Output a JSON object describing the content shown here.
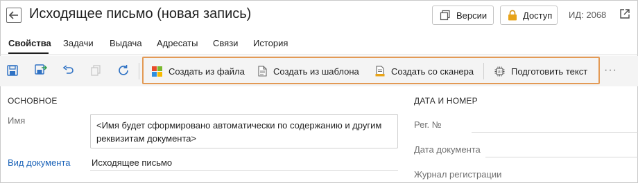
{
  "header": {
    "title": "Исходящее письмо (новая запись)",
    "versions_label": "Версии",
    "access_label": "Доступ",
    "id_label": "ИД: 2068"
  },
  "tabs": [
    {
      "label": "Свойства",
      "active": true
    },
    {
      "label": "Задачи"
    },
    {
      "label": "Выдача"
    },
    {
      "label": "Адресаты"
    },
    {
      "label": "Связи"
    },
    {
      "label": "История"
    }
  ],
  "toolbar": {
    "actions": [
      {
        "label": "Создать из файла",
        "icon": "windows-logo-icon"
      },
      {
        "label": "Создать из шаблона",
        "icon": "template-document-icon"
      },
      {
        "label": "Создать со сканера",
        "icon": "scanner-document-icon"
      },
      {
        "label": "Подготовить текст",
        "icon": "ai-chip-icon"
      }
    ],
    "more_label": "···",
    "highlight_color": "#e39a55"
  },
  "main": {
    "section_title": "ОСНОВНОЕ",
    "name_label": "Имя",
    "name_value": "<Имя будет сформировано автоматически по содержанию и другим реквизитам документа>",
    "doc_type_label": "Вид документа",
    "doc_type_value": "Исходящее письмо"
  },
  "side": {
    "section_title": "ДАТА И НОМЕР",
    "reg_no_label": "Рег. №",
    "doc_date_label": "Дата документа",
    "journal_label": "Журнал регистрации"
  },
  "colors": {
    "link": "#1b63b8",
    "icon_blue": "#2f72c4",
    "access_lock": "#e8a317"
  }
}
